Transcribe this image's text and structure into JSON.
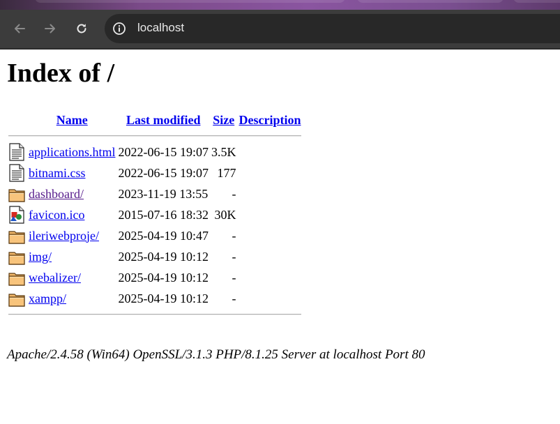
{
  "browser": {
    "url": "localhost",
    "icons": {
      "back": "arrow-left-icon",
      "forward": "arrow-right-icon",
      "reload": "reload-icon",
      "site_info": "info-icon"
    }
  },
  "page": {
    "heading": "Index of /",
    "columns": {
      "name": "Name",
      "modified": "Last modified",
      "size": "Size",
      "description": "Description"
    },
    "entries": [
      {
        "icon": "text-file-icon",
        "name": "applications.html",
        "modified": "2022-06-15 19:07",
        "size": "3.5K"
      },
      {
        "icon": "text-file-icon",
        "name": "bitnami.css",
        "modified": "2022-06-15 19:07",
        "size": "177"
      },
      {
        "icon": "folder-icon",
        "name": "dashboard/",
        "modified": "2023-11-19 13:55",
        "size": "-"
      },
      {
        "icon": "image-file-icon",
        "name": "favicon.ico",
        "modified": "2015-07-16 18:32",
        "size": "30K"
      },
      {
        "icon": "folder-icon",
        "name": "ileriwebproje/",
        "modified": "2025-04-19 10:47",
        "size": "-"
      },
      {
        "icon": "folder-icon",
        "name": "img/",
        "modified": "2025-04-19 10:12",
        "size": "-"
      },
      {
        "icon": "folder-icon",
        "name": "webalizer/",
        "modified": "2025-04-19 10:12",
        "size": "-"
      },
      {
        "icon": "folder-icon",
        "name": "xampp/",
        "modified": "2025-04-19 10:12",
        "size": "-"
      }
    ],
    "footer": "Apache/2.4.58 (Win64) OpenSSL/3.1.3 PHP/8.1.25 Server at localhost Port 80"
  },
  "colors": {
    "link": "#0000ee",
    "visited_link": "#551a8b",
    "toolbar": "#3c3c3c",
    "omnibox": "#282828"
  }
}
